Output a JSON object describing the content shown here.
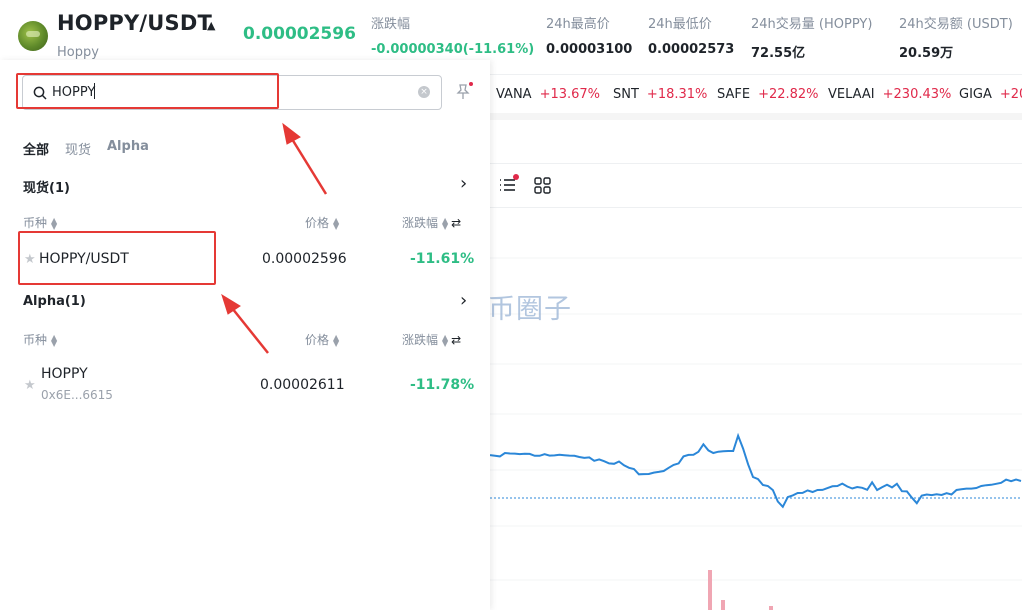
{
  "header": {
    "pair": "HOPPY/USDT",
    "caret": "▲",
    "name": "Hoppy",
    "price": "0.00002596",
    "stats": [
      {
        "label": "涨跌幅",
        "value": "-0.00000340(-11.61%)",
        "tone": "green"
      },
      {
        "label": "24h最高价",
        "value": "0.00003100",
        "tone": "dark"
      },
      {
        "label": "24h最低价",
        "value": "0.00002573",
        "tone": "dark"
      },
      {
        "label": "24h交易量 (HOPPY)",
        "value": "72.55亿",
        "tone": "dark"
      },
      {
        "label": "24h交易额 (USDT)",
        "value": "20.59万",
        "tone": "dark"
      }
    ]
  },
  "ticker": [
    {
      "symbol": "VANA",
      "change": "+13.67%"
    },
    {
      "symbol": "SNT",
      "change": "+18.31%"
    },
    {
      "symbol": "SAFE",
      "change": "+22.82%"
    },
    {
      "symbol": "VELAAI",
      "change": "+230.43%"
    },
    {
      "symbol": "GIGA",
      "change": "+20"
    }
  ],
  "search": {
    "value": "HOPPY",
    "clear": "×"
  },
  "tabs": [
    {
      "label": "全部",
      "active": true
    },
    {
      "label": "现货",
      "active": false
    },
    {
      "label": "Alpha",
      "active": false
    }
  ],
  "spot": {
    "title": "现货(1)",
    "chevron": "›",
    "cols": {
      "coin": "币种",
      "price": "价格",
      "change": "涨跌幅"
    },
    "rows": [
      {
        "symbol": "HOPPY/USDT",
        "price": "0.00002596",
        "change": "-11.61%"
      }
    ]
  },
  "alpha": {
    "title": "Alpha(1)",
    "chevron": "›",
    "cols": {
      "coin": "币种",
      "price": "价格",
      "change": "涨跌幅"
    },
    "rows": [
      {
        "symbol": "HOPPY",
        "address": "0x6E...6615",
        "price": "0.00002611",
        "change": "-11.78%"
      }
    ]
  },
  "watermark": {
    "text": "币圈子"
  },
  "colors": {
    "up": "#e0294a",
    "down": "#2ebd85",
    "line": "#2b87d8",
    "annotation": "#e53935"
  },
  "chart_data": {
    "type": "line",
    "series": [
      {
        "values": [
          0.536,
          0.528,
          0.52,
          0.563,
          0.556,
          0.555,
          0.549,
          0.554,
          0.551,
          0.527,
          0.528,
          0.547,
          0.53,
          0.532,
          0.54,
          0.535,
          0.53,
          0.528,
          0.512,
          0.501,
          0.508,
          0.465,
          0.483,
          0.46,
          0.433,
          0.428,
          0.456,
          0.409,
          0.378,
          0.363,
          0.296,
          0.299,
          0.3,
          0.317,
          0.326,
          0.338,
          0.377,
          0.414,
          0.433,
          0.52,
          0.539,
          0.541,
          0.578,
          0.671,
          0.595,
          0.562,
          0.579,
          0.585,
          0.588,
          0.588,
          0.779,
          0.618,
          0.421,
          0.263,
          0.236,
          0.162,
          0.15,
          0.099,
          -0.044,
          -0.11,
          0.011,
          0.033,
          0.062,
          0.064,
          0.095,
          0.075,
          0.1,
          0.101,
          0.124,
          0.146,
          0.15,
          0.18,
          0.144,
          0.119,
          0.137,
          0.128,
          0.103,
          0.196,
          0.1,
          0.134,
          0.166,
          0.133,
          0.177,
          0.085,
          0.083,
          0.005,
          -0.065,
          0.03,
          0.044,
          0.036,
          0.046,
          0.038,
          0.06,
          0.044,
          0.1,
          0.109,
          0.117,
          0.118,
          0.125,
          0.15,
          0.16,
          0.165,
          0.178,
          0.19,
          0.23,
          0.21,
          0.231,
          0.213
        ]
      }
    ]
  }
}
